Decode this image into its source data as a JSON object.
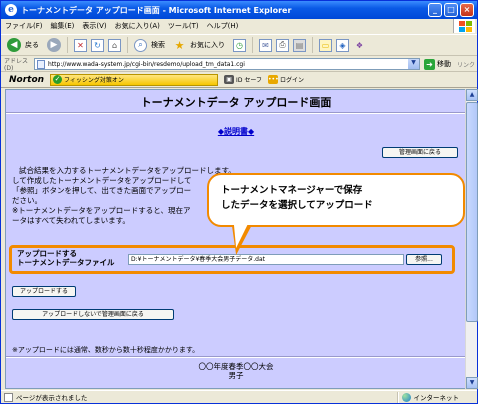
{
  "window": {
    "title": "トーナメントデータ アップロード画面 - Microsoft Internet Explorer"
  },
  "menu": [
    "ファイル(F)",
    "編集(E)",
    "表示(V)",
    "お気に入り(A)",
    "ツール(T)",
    "ヘルプ(H)"
  ],
  "toolbar": {
    "back": "戻る",
    "search": "検索",
    "favorites": "お気に入り"
  },
  "address": {
    "label": "アドレス(D)",
    "url": "http://www.wada-system.jp/cgi-bin/resdemo/upload_tm_data1.cgi",
    "go": "移動",
    "links": "リンク"
  },
  "norton": {
    "brand": "Norton",
    "phishing": "フィッシング対策オン",
    "id_safe": "ID セーフ",
    "login": "ログイン"
  },
  "page": {
    "heading": "トーナメントデータ アップロード画面",
    "manual_link": "◆説明書◆",
    "back_button": "管理画面に戻る",
    "para_line1": "試合結果を入力するトーナメントデータをアップロードします。",
    "para_line2": "して作成したトーナメントデータをアップロードして",
    "para_line3": "「参照」ボタンを押して、出てきた画面でアップロー",
    "para_line4": "ださい。",
    "para_line5": "※トーナメントデータをアップロードすると、現在ア",
    "para_line6": "ータはすべて失われてしまいます。",
    "file_label_line1": "アップロードする",
    "file_label_line2": "トーナメントデータファイル",
    "file_value": "D:¥トーナメントデータ¥春季大会男子データ.dat",
    "browse_button": "参照...",
    "upload_button": "アップロードする",
    "back_without_upload_button": "アップロードしないで管理画面に戻る",
    "notice": "※アップロードには通常、数秒から数十秒程度かかります。",
    "footer_line1": "〇〇年度春季〇〇大会",
    "footer_line2": "男子"
  },
  "callout": {
    "line1": "トーナメントマネージャーで保存",
    "line2": "したデータを選択してアップロード"
  },
  "status": {
    "text": "ページが表示されました",
    "zone": "インターネット"
  }
}
